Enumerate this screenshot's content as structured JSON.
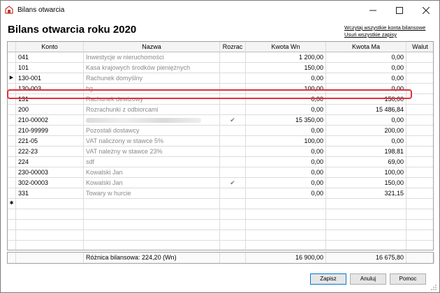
{
  "window": {
    "title": "Bilans otwarcia"
  },
  "page": {
    "title": "Bilans otwarcia roku 2020"
  },
  "links": {
    "load_all": "Wczytaj wszystkie konta bilansowe",
    "delete_all": "Usuń wszystkie zapisy"
  },
  "table": {
    "columns": {
      "konto": "Konto",
      "nazwa": "Nazwa",
      "rozrac": "Rozrac",
      "wn": "Kwota Wn",
      "ma": "Kwota Ma",
      "waluta": "Walut"
    },
    "rows": [
      {
        "konto": "041",
        "nazwa": "Inwestycje w nieruchomości",
        "rozrac": "",
        "wn": "1 200,00",
        "ma": "0,00"
      },
      {
        "konto": "101",
        "nazwa": "Kasa krajowych środków pieniężnych",
        "rozrac": "",
        "wn": "150,00",
        "ma": "0,00"
      },
      {
        "konto": "130-001",
        "nazwa": "Rachunek domyślny",
        "rozrac": "",
        "wn": "0,00",
        "ma": "0,00",
        "current": true
      },
      {
        "konto": "130-003",
        "nazwa": "bg",
        "rozrac": "",
        "wn": "100,00",
        "ma": "0,00"
      },
      {
        "konto": "131",
        "nazwa": "Rachunek dewizowy",
        "rozrac": "",
        "wn": "0,00",
        "ma": "150,00"
      },
      {
        "konto": "200",
        "nazwa": "Rozrachunki z odbiorcami",
        "rozrac": "",
        "wn": "0,00",
        "ma": "15 486,84"
      },
      {
        "konto": "210-00002",
        "nazwa": "",
        "blurred": true,
        "rozrac": "✔",
        "wn": "15 350,00",
        "ma": "0,00"
      },
      {
        "konto": "210-99999",
        "nazwa": "Pozostali dostawcy",
        "rozrac": "",
        "wn": "0,00",
        "ma": "200,00"
      },
      {
        "konto": "221-05",
        "nazwa": "VAT naliczony w stawce 5%",
        "rozrac": "",
        "wn": "100,00",
        "ma": "0,00"
      },
      {
        "konto": "222-23",
        "nazwa": "VAT należny w stawce 23%",
        "rozrac": "",
        "wn": "0,00",
        "ma": "198,81"
      },
      {
        "konto": "224",
        "nazwa": "sdf",
        "rozrac": "",
        "wn": "0,00",
        "ma": "69,00"
      },
      {
        "konto": "230-00003",
        "nazwa": " Kowalski Jan",
        "rozrac": "",
        "wn": "0,00",
        "ma": "100,00"
      },
      {
        "konto": "302-00003",
        "nazwa": " Kowalski Jan",
        "rozrac": "✔",
        "wn": "0,00",
        "ma": "150,00"
      },
      {
        "konto": "331",
        "nazwa": "Towary w hurcie",
        "rozrac": "",
        "wn": "0,00",
        "ma": "321,15"
      }
    ],
    "new_row_marker": "✱",
    "current_row_marker": "▶"
  },
  "summary": {
    "label": "Różnica bilansowa: 224,20 (Wn)",
    "wn": "16 900,00",
    "ma": "16 675,80"
  },
  "buttons": {
    "save": "Zapisz",
    "cancel": "Anuluj",
    "help": "Pomoc"
  },
  "colors": {
    "highlight": "#e0303a",
    "accent": "#0078d7"
  }
}
